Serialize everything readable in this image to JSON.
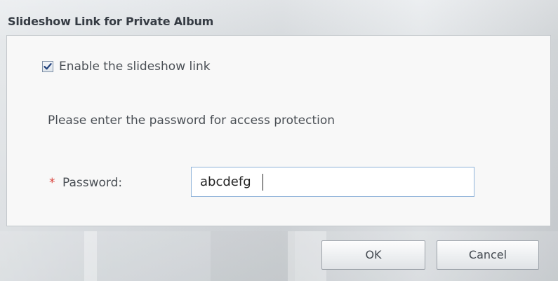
{
  "dialog": {
    "title": "Slideshow Link for Private Album"
  },
  "form": {
    "enable_checkbox": {
      "label": "Enable the slideshow link",
      "checked": true
    },
    "instruction": "Please enter the password for access protection",
    "password": {
      "required_marker": "*",
      "label": "Password:",
      "value": "abcdefg"
    }
  },
  "buttons": {
    "ok_label": "OK",
    "cancel_label": "Cancel"
  },
  "icons": {
    "checkbox": "checkmark-icon"
  }
}
